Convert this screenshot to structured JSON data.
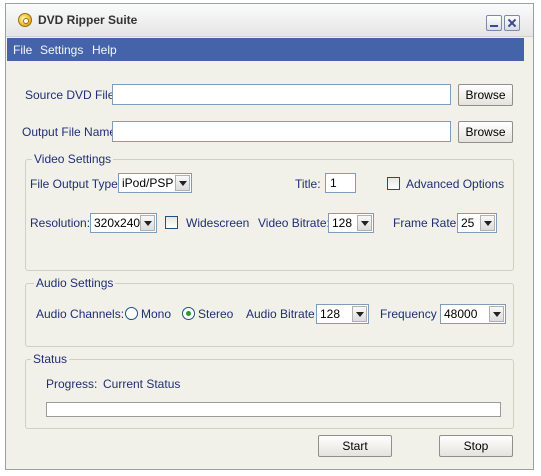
{
  "window": {
    "title": "DVD Ripper Suite",
    "icon": "dvd-disc-icon"
  },
  "menu": {
    "items": [
      "File",
      "Settings",
      "Help"
    ]
  },
  "source": {
    "label": "Source DVD File",
    "value": "",
    "browse_label": "Browse"
  },
  "output": {
    "label": "Output File Name:",
    "value": "",
    "browse_label": "Browse"
  },
  "video": {
    "group_label": "Video Settings",
    "output_type_label": "File  Output Type",
    "output_type_value": "iPod/PSP",
    "title_label": "Title:",
    "title_value": "1",
    "advanced_label": "Advanced Options",
    "advanced_checked": false,
    "resolution_label": "Resolution:",
    "resolution_value": "320x240",
    "widescreen_label": "Widescreen",
    "widescreen_checked": false,
    "bitrate_label": "Video Bitrate:",
    "bitrate_value": "128",
    "framerate_label": "Frame Rate:",
    "framerate_value": "25"
  },
  "audio": {
    "group_label": "Audio Settings",
    "channels_label": "Audio Channels:",
    "mono_label": "Mono",
    "stereo_label": "Stereo",
    "selected_channel": "Stereo",
    "bitrate_label": "Audio Bitrate",
    "bitrate_value": "128",
    "frequency_label": "Frequency",
    "frequency_value": "48000"
  },
  "status": {
    "group_label": "Status",
    "progress_label": "Progress:",
    "status_text": "Current Status",
    "progress_fraction": 0
  },
  "actions": {
    "start_label": "Start",
    "stop_label": "Stop"
  },
  "colors": {
    "menubar": "#4563a8",
    "label_text": "#1f2f74",
    "window_bg": "#f1f0e9"
  }
}
